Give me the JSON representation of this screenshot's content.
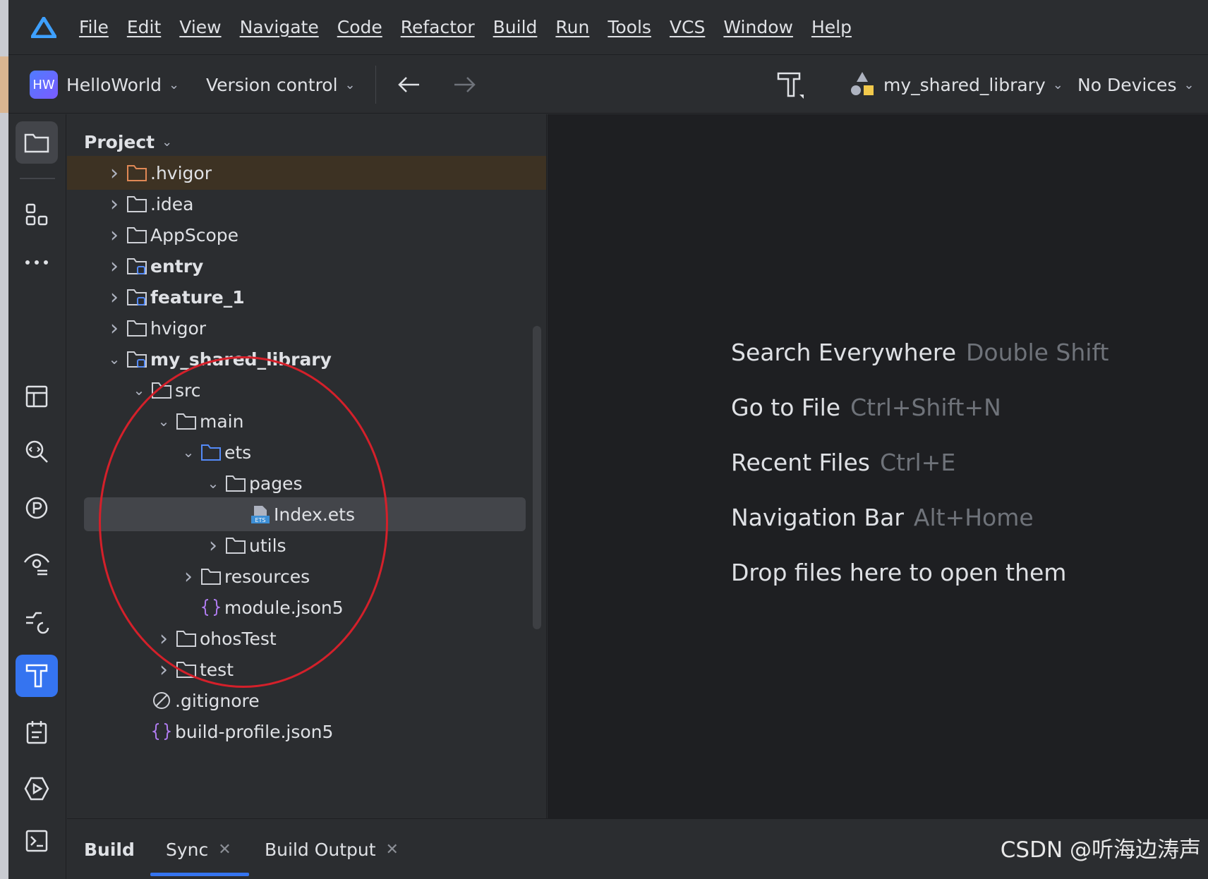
{
  "menubar": {
    "items": [
      "File",
      "Edit",
      "View",
      "Navigate",
      "Code",
      "Refactor",
      "Build",
      "Run",
      "Tools",
      "VCS",
      "Window",
      "Help"
    ]
  },
  "toolbar": {
    "project_badge": "HW",
    "project_name": "HelloWorld",
    "version_control": "Version control",
    "module": "my_shared_library",
    "devices": "No Devices"
  },
  "project_panel": {
    "title": "Project",
    "tree": [
      {
        "label": ".hvigor",
        "type": "folder-excluded",
        "depth": 0,
        "expandable": true
      },
      {
        "label": ".idea",
        "type": "folder",
        "depth": 0,
        "expandable": true
      },
      {
        "label": "AppScope",
        "type": "folder",
        "depth": 0,
        "expandable": true
      },
      {
        "label": "entry",
        "type": "module",
        "depth": 0,
        "expandable": true,
        "bold": true
      },
      {
        "label": "feature_1",
        "type": "module",
        "depth": 0,
        "expandable": true,
        "bold": true
      },
      {
        "label": "hvigor",
        "type": "folder",
        "depth": 0,
        "expandable": true
      },
      {
        "label": "my_shared_library",
        "type": "module",
        "depth": 0,
        "expanded": true,
        "bold": true
      },
      {
        "label": "src",
        "type": "folder",
        "depth": 1,
        "expanded": true
      },
      {
        "label": "main",
        "type": "folder",
        "depth": 2,
        "expanded": true
      },
      {
        "label": "ets",
        "type": "folder-source",
        "depth": 3,
        "expanded": true
      },
      {
        "label": "pages",
        "type": "folder",
        "depth": 4,
        "expanded": true
      },
      {
        "label": "Index.ets",
        "type": "ets-file",
        "depth": 5,
        "selected": true
      },
      {
        "label": "utils",
        "type": "folder",
        "depth": 4,
        "expandable": true
      },
      {
        "label": "resources",
        "type": "folder",
        "depth": 3,
        "expandable": true
      },
      {
        "label": "module.json5",
        "type": "json-file",
        "depth": 3
      },
      {
        "label": "ohosTest",
        "type": "folder",
        "depth": 2,
        "expandable": true
      },
      {
        "label": "test",
        "type": "folder",
        "depth": 2,
        "expandable": true
      },
      {
        "label": ".gitignore",
        "type": "ignore-file",
        "depth": 1
      },
      {
        "label": "build-profile.json5",
        "type": "json-file",
        "depth": 1
      }
    ]
  },
  "editor": {
    "hints": [
      {
        "action": "Search Everywhere",
        "shortcut": "Double Shift"
      },
      {
        "action": "Go to File",
        "shortcut": "Ctrl+Shift+N"
      },
      {
        "action": "Recent Files",
        "shortcut": "Ctrl+E"
      },
      {
        "action": "Navigation Bar",
        "shortcut": "Alt+Home"
      },
      {
        "action": "Drop files here to open them",
        "shortcut": ""
      }
    ]
  },
  "bottom_panel": {
    "title": "Build",
    "tabs": [
      "Sync",
      "Build Output"
    ]
  },
  "watermark": "CSDN @听海边涛声",
  "colors": {
    "accent": "#3574f0",
    "annotation": "#d4202a",
    "background": "#2b2d30",
    "editor_background": "#1e1f22"
  }
}
